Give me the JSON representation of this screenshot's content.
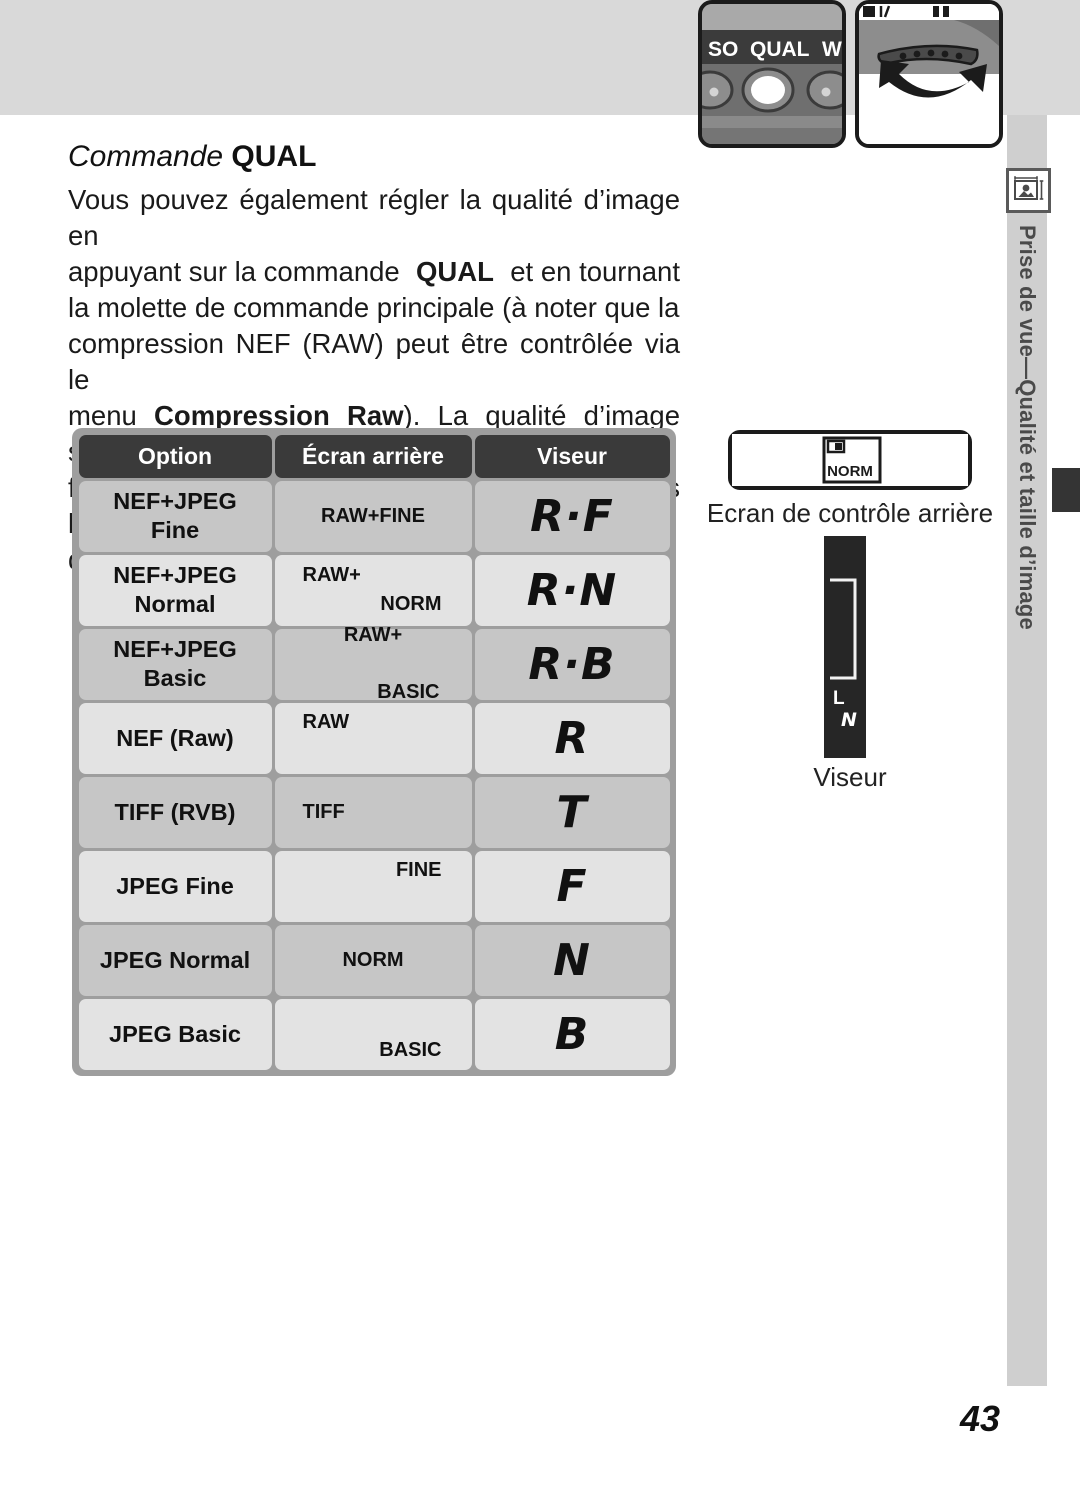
{
  "side_tab": {
    "label": "Prise de vue—Qualité et taille d’image",
    "icon": "image-size-icon"
  },
  "heading": {
    "italic_part": "Commande ",
    "bold_part": "QUAL"
  },
  "body": {
    "line1": "Vous pouvez également régler la qualité d’image en",
    "line2_a": "appuyant sur la commande ",
    "line2_b": "QUAL",
    "line2_c": " et en tournant",
    "line3": "la molette de commande principale (à noter que la",
    "line4": "compression NEF (RAW) peut être contrôlée via le",
    "line5_a": "menu ",
    "line5_b": "Compression Raw",
    "line5_c": "). La qualité d’image s’af-",
    "line6": "fiche sur l’écran de contrôle arrière et dans l’encadré",
    "line7": "du viseur :"
  },
  "illustrations": {
    "qual_button_labels": [
      "SO",
      "QUAL",
      "W"
    ],
    "dial_arrow": "rotate-dial-arrow"
  },
  "table": {
    "headers": [
      "Option",
      "Écran arrière",
      "Viseur"
    ],
    "rows": [
      {
        "option": [
          "NEF+JPEG",
          "Fine"
        ],
        "lcd_mode": "single",
        "lcd": [
          "RAW+FINE"
        ],
        "viewfinder": "R·F"
      },
      {
        "option": [
          "NEF+JPEG",
          "Normal"
        ],
        "lcd_mode": "stagger",
        "lcd": [
          "RAW+",
          "NORM"
        ],
        "viewfinder": "R·N"
      },
      {
        "option": [
          "NEF+JPEG",
          "Basic"
        ],
        "lcd_mode": "spread",
        "lcd": [
          "RAW+",
          "BASIC"
        ],
        "viewfinder": "R·B"
      },
      {
        "option": [
          "NEF (Raw)"
        ],
        "lcd_mode": "top",
        "lcd": [
          "RAW"
        ],
        "viewfinder": "R"
      },
      {
        "option": [
          "TIFF (RVB)"
        ],
        "lcd_mode": "left",
        "lcd": [
          "TIFF"
        ],
        "viewfinder": "T"
      },
      {
        "option": [
          "JPEG Fine"
        ],
        "lcd_mode": "topright",
        "lcd": [
          "FINE"
        ],
        "viewfinder": "F"
      },
      {
        "option": [
          "JPEG Normal"
        ],
        "lcd_mode": "single",
        "lcd": [
          "NORM"
        ],
        "viewfinder": "N"
      },
      {
        "option": [
          "JPEG Basic"
        ],
        "lcd_mode": "botright",
        "lcd": [
          "BASIC"
        ],
        "viewfinder": "B"
      }
    ]
  },
  "figures": {
    "rear_panel_value": "NORM",
    "rear_panel_caption": "Ecran de contrôle arrière",
    "viewfinder_labels": [
      "L",
      "N"
    ],
    "viewfinder_caption": "Viseur"
  },
  "page_number": "43"
}
